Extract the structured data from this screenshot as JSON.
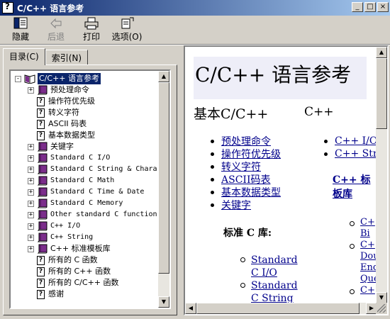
{
  "window": {
    "title": "C/C++ 语言参考"
  },
  "toolbar": {
    "hide": "隐藏",
    "back": "后退",
    "print": "打印",
    "options": "选项(O)"
  },
  "tabs": {
    "contents": "目录(C)",
    "index": "索引(N)"
  },
  "tree": [
    {
      "label": "C/C++ 语言参考",
      "type": "book-open",
      "expander": "-",
      "mono": false,
      "selected": true
    },
    {
      "label": "预处理命令",
      "type": "book",
      "expander": "+",
      "mono": false
    },
    {
      "label": "操作符优先级",
      "type": "page",
      "mono": false
    },
    {
      "label": "转义字符",
      "type": "page",
      "mono": false
    },
    {
      "label": "ASCII 码表",
      "type": "page",
      "mono": false
    },
    {
      "label": "基本数据类型",
      "type": "page",
      "mono": false
    },
    {
      "label": "关键字",
      "type": "book",
      "expander": "+",
      "mono": false
    },
    {
      "label": "Standard C I/O",
      "type": "book",
      "expander": "+",
      "mono": true
    },
    {
      "label": "Standard C String & Chara",
      "type": "book",
      "expander": "+",
      "mono": true
    },
    {
      "label": "Standard C Math",
      "type": "book",
      "expander": "+",
      "mono": true
    },
    {
      "label": "Standard C Time & Date",
      "type": "book",
      "expander": "+",
      "mono": true
    },
    {
      "label": "Standard C Memory",
      "type": "book",
      "expander": "+",
      "mono": true
    },
    {
      "label": "Other standard C function",
      "type": "book",
      "expander": "+",
      "mono": true
    },
    {
      "label": "C++ I/O",
      "type": "book",
      "expander": "+",
      "mono": true
    },
    {
      "label": "C++ String",
      "type": "book",
      "expander": "+",
      "mono": true
    },
    {
      "label": "C++ 标准模板库",
      "type": "book",
      "expander": "+",
      "mono": false
    },
    {
      "label": "所有的 C 函数",
      "type": "page",
      "mono": false
    },
    {
      "label": "所有的 C++ 函数",
      "type": "page",
      "mono": false
    },
    {
      "label": "所有的 C/C++ 函数",
      "type": "page",
      "mono": false
    },
    {
      "label": "感谢",
      "type": "page",
      "mono": false
    }
  ],
  "content": {
    "title": "C/C++ 语言参考",
    "subtitle": "基本C/C++",
    "subtitle2": "C++",
    "basic_links": [
      "预处理命令",
      "操作符优先级",
      "转义字符",
      "ASCII码表",
      "基本数据类型",
      "关键字"
    ],
    "cpp_links": [
      "C++ I/O",
      "C++ Stri"
    ],
    "cpp_stl_heading_1": "C++ 标",
    "cpp_stl_heading_2": "板库",
    "std_c_heading": "标准 C 库:",
    "std_c_links": [
      {
        "line1": "Standard",
        "line2": "C I/O"
      },
      {
        "line1": "Standard",
        "line2": "C String"
      }
    ],
    "side_links": [
      {
        "line1": "C+",
        "line2": "Bi"
      },
      {
        "line1": "C+",
        "line2": "Dou",
        "line3": "End",
        "line4": "Que"
      },
      {
        "line1": "C+"
      }
    ]
  },
  "colors": {
    "titlebar_start": "#0a246a",
    "titlebar_end": "#a6caf0",
    "link": "#00008b",
    "title_bg": "#eeeef8",
    "selection": "#0a246a",
    "book": "#7b2d8b"
  }
}
